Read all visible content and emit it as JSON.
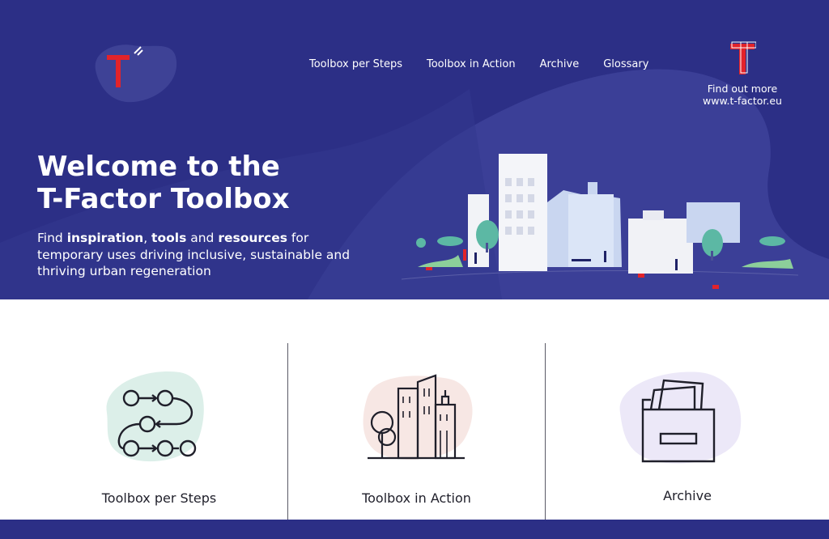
{
  "brand": {
    "logo_letter": "T",
    "primary_color": "#2c2f86",
    "accent_red": "#e2232a"
  },
  "nav": {
    "items": [
      {
        "label": "Toolbox per Steps"
      },
      {
        "label": "Toolbox in Action"
      },
      {
        "label": "Archive"
      },
      {
        "label": "Glossary"
      }
    ]
  },
  "find_more": {
    "line1": "Find out more",
    "line2": "www.t-factor.eu"
  },
  "hero": {
    "title_line1": "Welcome to the",
    "title_line2": "T-Factor Toolbox",
    "sub_part1": "Find ",
    "sub_bold1": "inspiration",
    "sub_part2": ", ",
    "sub_bold2": "tools",
    "sub_part3": " and ",
    "sub_bold3": "resources",
    "sub_part4": " for temporary uses driving inclusive, sustainable and thriving urban regeneration"
  },
  "cards": [
    {
      "label": "Toolbox per Steps",
      "icon": "steps-flow-icon",
      "blob_color": "#dcefe9"
    },
    {
      "label": "Toolbox in Action",
      "icon": "buildings-icon",
      "blob_color": "#f7e7e4"
    },
    {
      "label": "Archive",
      "icon": "archive-box-icon",
      "blob_color": "#ece8f8"
    }
  ]
}
